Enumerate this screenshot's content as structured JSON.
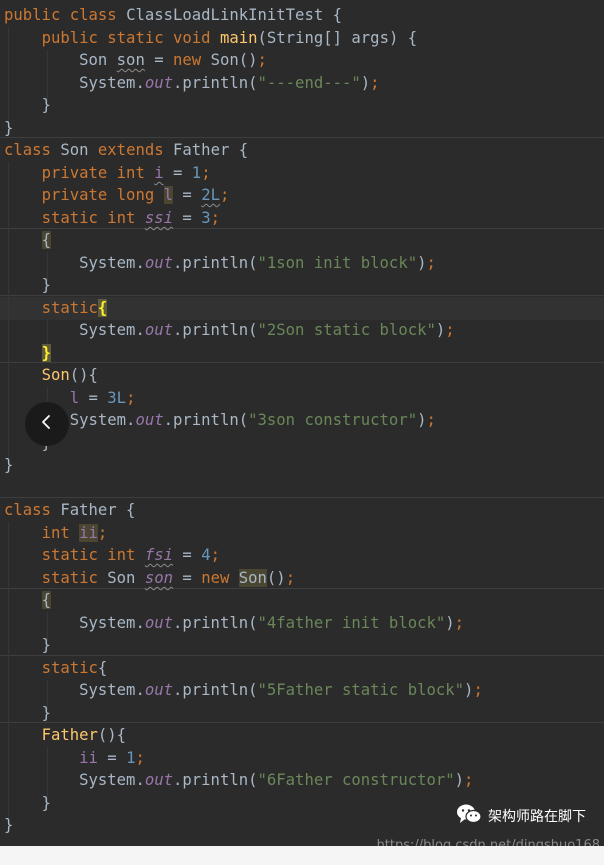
{
  "code": {
    "L1": {
      "a": "public ",
      "b": "class ",
      "c": "ClassLoadLinkInitTest {"
    },
    "L2": {
      "a": "public ",
      "b": "static ",
      "c": "void ",
      "d": "main",
      "e": "(String[] args) {"
    },
    "L3": {
      "a": "Son ",
      "b": "son",
      "c": " = ",
      "d": "new ",
      "e": "Son()",
      "f": ";"
    },
    "L4": {
      "a": "System.",
      "b": "out",
      "c": ".println(",
      "d": "\"---end---\"",
      "e": ")",
      "f": ";"
    },
    "L5": {
      "a": "}"
    },
    "L6": {
      "a": "}"
    },
    "L7": {
      "a": "class ",
      "b": "Son ",
      "c": "extends ",
      "d": "Father {"
    },
    "L8": {
      "a": "private ",
      "b": "int ",
      "c": "i",
      "d": " = ",
      "e": "1",
      "f": ";"
    },
    "L9": {
      "a": "private ",
      "b": "long ",
      "c": "l",
      "d": " = ",
      "e": "2L",
      "f": ";"
    },
    "L10": {
      "a": "static ",
      "b": "int ",
      "c": "ssi",
      "d": " = ",
      "e": "3",
      "f": ";"
    },
    "L11": {
      "a": "{"
    },
    "L12": {
      "a": "System.",
      "b": "out",
      "c": ".println(",
      "d": "\"1son init block\"",
      "e": ")",
      "f": ";"
    },
    "L13": {
      "a": "}"
    },
    "L14": {
      "a": "static",
      "b": "{"
    },
    "L15": {
      "a": "System.",
      "b": "out",
      "c": ".println(",
      "d": "\"2Son static block\"",
      "e": ")",
      "f": ";"
    },
    "L16": {
      "a": "}"
    },
    "L17": {
      "a": "Son",
      "b": "(){"
    },
    "L18": {
      "a": "l",
      "b": " = ",
      "c": "3L",
      "d": ";"
    },
    "L19": {
      "a": "System.",
      "b": "out",
      "c": ".println(",
      "d": "\"3son constructor\"",
      "e": ")",
      "f": ";"
    },
    "L20": {
      "a": "}"
    },
    "L21": {
      "a": "}"
    },
    "L22": {
      "a": "class ",
      "b": "Father {"
    },
    "L23": {
      "a": "int ",
      "b": "ii",
      "c": ";"
    },
    "L24": {
      "a": "static ",
      "b": "int ",
      "c": "fsi",
      "d": " = ",
      "e": "4",
      "f": ";"
    },
    "L25": {
      "a": "static ",
      "b": "Son ",
      "c": "son",
      "d": " = ",
      "e": "new ",
      "f": "Son",
      "g": "()",
      "h": ";"
    },
    "L26": {
      "a": "{"
    },
    "L27": {
      "a": "System.",
      "b": "out",
      "c": ".println(",
      "d": "\"4father init block\"",
      "e": ")",
      "f": ";"
    },
    "L28": {
      "a": "}"
    },
    "L29": {
      "a": "static",
      "b": "{"
    },
    "L30": {
      "a": "System.",
      "b": "out",
      "c": ".println(",
      "d": "\"5Father static block\"",
      "e": ")",
      "f": ";"
    },
    "L31": {
      "a": "}"
    },
    "L32": {
      "a": "Father",
      "b": "(){"
    },
    "L33": {
      "a": "ii",
      "b": " = ",
      "c": "1",
      "d": ";"
    },
    "L34": {
      "a": "System.",
      "b": "out",
      "c": ".println(",
      "d": "\"6Father constructor\"",
      "e": ")",
      "f": ";"
    },
    "L35": {
      "a": "}"
    },
    "L36": {
      "a": "}"
    }
  },
  "overlay": {
    "back_icon": "chevron-left-icon",
    "watermark_icon": "wechat-icon",
    "watermark_text": "架构师路在脚下",
    "url_text": "https://blog.csdn.net/dingshuo168"
  },
  "colors": {
    "background": "#2b2b2b",
    "keyword": "#cc7832",
    "method": "#ffc66d",
    "string": "#6a8759",
    "number": "#6897bb",
    "field": "#9876aa",
    "text": "#a9b7c6"
  }
}
